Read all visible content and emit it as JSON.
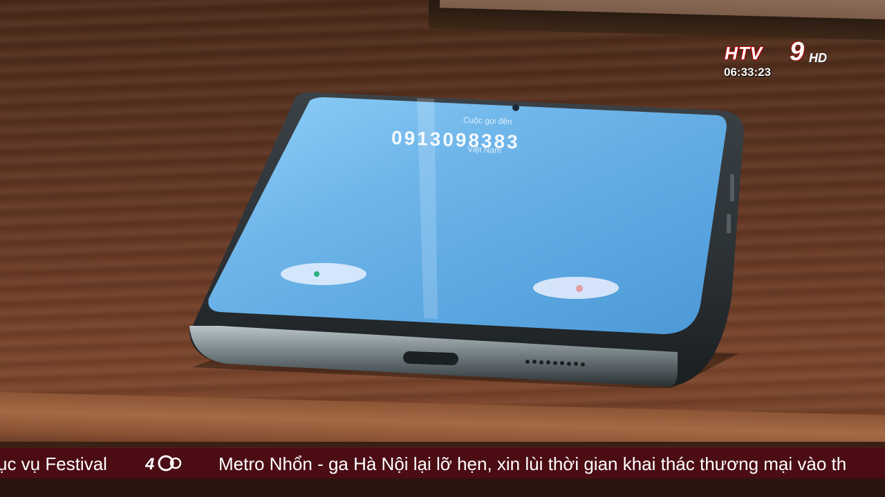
{
  "overlay": {
    "channel_logo": {
      "htv": "HTV",
      "nine": "9",
      "hd": "HD"
    },
    "clock": "06:33:23"
  },
  "phone_screen": {
    "call_label": "Cuộc gọi đến",
    "phone_number": "0913098383",
    "region": "Việt Nam"
  },
  "ticker": {
    "left_text": "ục vụ Festival",
    "main_text": "Metro Nhổn - ga Hà Nội lại lỡ hẹn, xin lùi thời gian khai thác thương mại vào th"
  },
  "colors": {
    "ticker_bg": "#4b0c14",
    "screen_blue": "#6fb6ea",
    "logo_red": "#b00010"
  }
}
